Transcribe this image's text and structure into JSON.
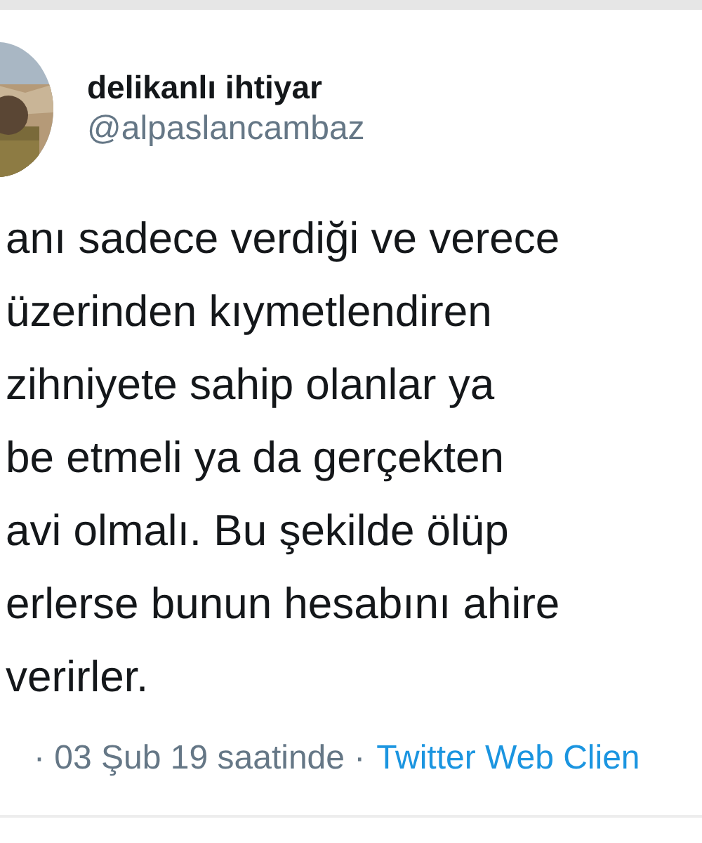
{
  "author": {
    "name": "delikanlı ihtiyar",
    "handle": "@alpaslancambaz"
  },
  "tweet_lines": [
    "anı sadece verdiği ve verece",
    "üzerinden kıymetlendiren",
    "zihniyete sahip olanlar ya",
    "be etmeli ya da gerçekten",
    "avi olmalı. Bu şekilde ölüp",
    "erlerse bunun hesabını ahire",
    "verirler."
  ],
  "meta": {
    "timestamp": "· 03 Şub 19 saatinde ·",
    "source": "Twitter Web Clien"
  }
}
